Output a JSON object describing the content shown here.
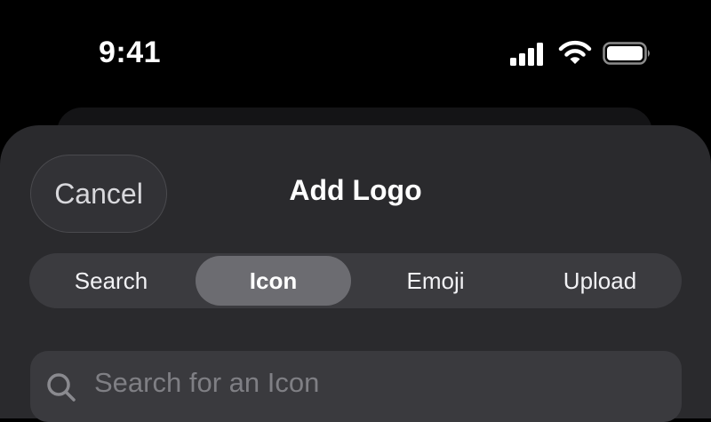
{
  "status_bar": {
    "time": "9:41",
    "icons": [
      "cellular-signal-icon",
      "wifi-icon",
      "battery-icon"
    ]
  },
  "sheet": {
    "cancel_label": "Cancel",
    "title": "Add Logo"
  },
  "tabs": [
    {
      "label": "Search",
      "selected": false
    },
    {
      "label": "Icon",
      "selected": true
    },
    {
      "label": "Emoji",
      "selected": false
    },
    {
      "label": "Upload",
      "selected": false
    }
  ],
  "search": {
    "placeholder": "Search for an Icon",
    "value": "",
    "icon": "search-icon"
  },
  "colors": {
    "background": "#000000",
    "sheet": "#2a2a2d",
    "segment_track": "#3b3b3f",
    "segment_selected": "#6c6c71",
    "search_field": "#3a3a3e",
    "placeholder": "#7f7f84"
  }
}
